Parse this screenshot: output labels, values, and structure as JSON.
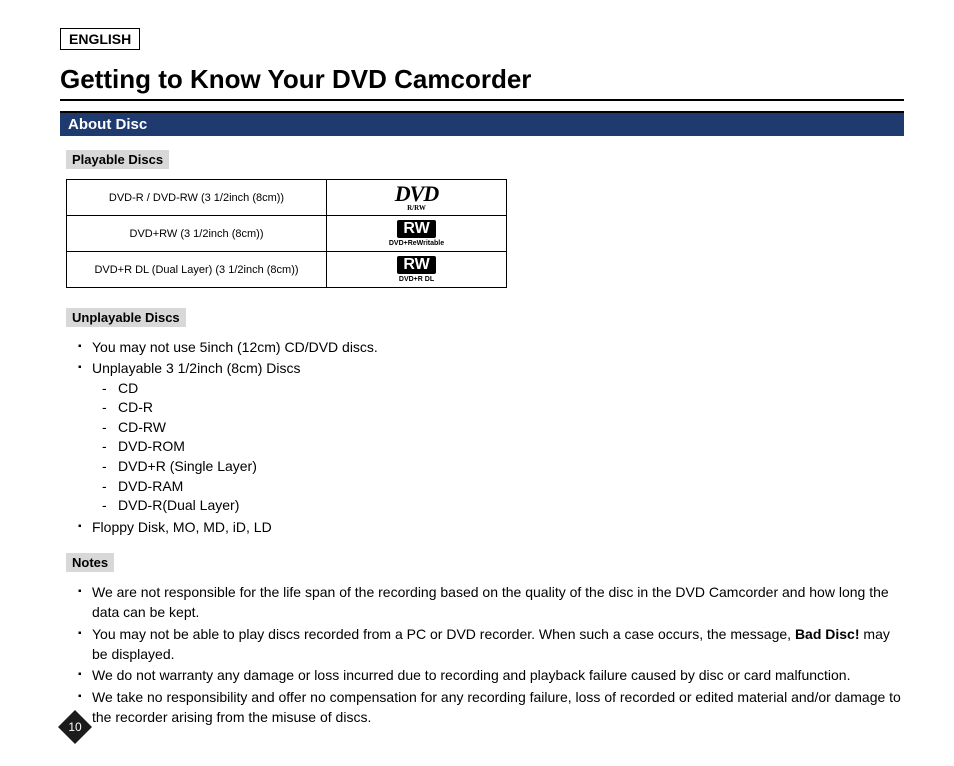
{
  "language_label": "ENGLISH",
  "page_title": "Getting to Know Your DVD Camcorder",
  "section_bar": "About Disc",
  "playable": {
    "heading": "Playable Discs",
    "rows": [
      {
        "desc": "DVD-R / DVD-RW (3 1/2inch (8cm))",
        "logo_text": "DVD",
        "logo_sub": "R/RW"
      },
      {
        "desc": "DVD+RW (3 1/2inch (8cm))",
        "logo_text": "RW",
        "logo_sub": "DVD+ReWritable"
      },
      {
        "desc": "DVD+R DL (Dual Layer) (3 1/2inch (8cm))",
        "logo_text": "RW",
        "logo_sub": "DVD+R DL"
      }
    ]
  },
  "unplayable": {
    "heading": "Unplayable Discs",
    "item1": "You may not use 5inch (12cm) CD/DVD discs.",
    "item2": "Unplayable 3 1/2inch (8cm) Discs",
    "sublist": [
      "CD",
      "CD-R",
      "CD-RW",
      "DVD-ROM",
      "DVD+R (Single Layer)",
      "DVD-RAM",
      "DVD-R(Dual Layer)"
    ],
    "item3": "Floppy Disk, MO, MD, iD, LD"
  },
  "notes": {
    "heading": "Notes",
    "n1": "We are not responsible for the life span of the recording based on the quality of the disc in the DVD Camcorder and how long the data can be kept.",
    "n2a": "You may not be able to play discs recorded from a PC or DVD recorder. When such a case occurs, the message, ",
    "n2b": "Bad Disc!",
    "n2c": " may be displayed.",
    "n3": "We do not warranty any damage or loss incurred due to recording and playback failure caused by disc or card malfunction.",
    "n4": "We take no responsibility and offer no compensation for any recording failure, loss of recorded or edited material and/or damage to the recorder arising from the misuse of discs."
  },
  "page_number": "10"
}
